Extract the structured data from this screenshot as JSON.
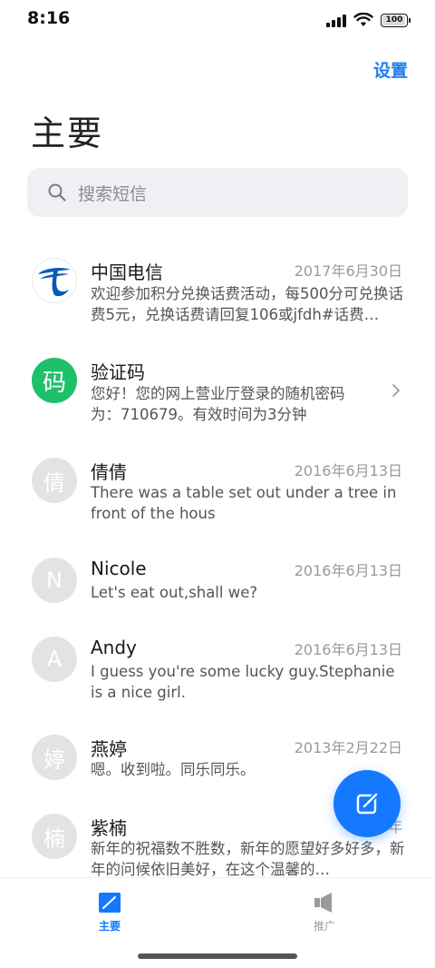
{
  "status_bar": {
    "time": "8:16",
    "battery": "100"
  },
  "header": {
    "settings": "设置",
    "title": "主要"
  },
  "search": {
    "placeholder": "搜索短信"
  },
  "messages": [
    {
      "name": "中国电信",
      "date": "2017年6月30日",
      "preview": "欢迎参加积分兑换话费活动，每500分可兑换话费5元，兑换话费请回复106或jfdh#话费…",
      "avatar_type": "telecom-logo",
      "avatar_text": ""
    },
    {
      "name": "验证码",
      "date": "",
      "preview": "您好！您的网上营业厅登录的随机密码为：710679。有效时间为3分钟",
      "avatar_type": "green",
      "avatar_text": "码"
    },
    {
      "name": "倩倩",
      "date": "2016年6月13日",
      "preview": "There was a table set out under a tree in front of the hous",
      "avatar_type": "grey",
      "avatar_text": "倩"
    },
    {
      "name": "Nicole",
      "date": "2016年6月13日",
      "preview": "Let's eat out,shall we?",
      "avatar_type": "grey",
      "avatar_text": "N"
    },
    {
      "name": "Andy",
      "date": "2016年6月13日",
      "preview": "I guess you're some lucky guy.Stephanie is a nice girl.",
      "avatar_type": "grey",
      "avatar_text": "A"
    },
    {
      "name": "燕婷",
      "date": "2013年2月22日",
      "preview": "嗯。收到啦。同乐同乐。",
      "avatar_type": "grey",
      "avatar_text": "婷"
    },
    {
      "name": "紫楠",
      "date": "2013年",
      "preview": "新年的祝福数不胜数，新年的愿望好多好多，新年的问候依旧美好，在这个温馨的…",
      "avatar_type": "grey",
      "avatar_text": "楠"
    }
  ],
  "bottom_nav": {
    "tabs": [
      {
        "label": "主要",
        "icon": "edit-square-icon",
        "active": true
      },
      {
        "label": "推广",
        "icon": "megaphone-icon",
        "active": false
      }
    ]
  },
  "colors": {
    "accent": "#1479ff",
    "link": "#1d7ff0",
    "verification_avatar": "#1fc06a",
    "avatar_grey": "#e3e3e3"
  }
}
